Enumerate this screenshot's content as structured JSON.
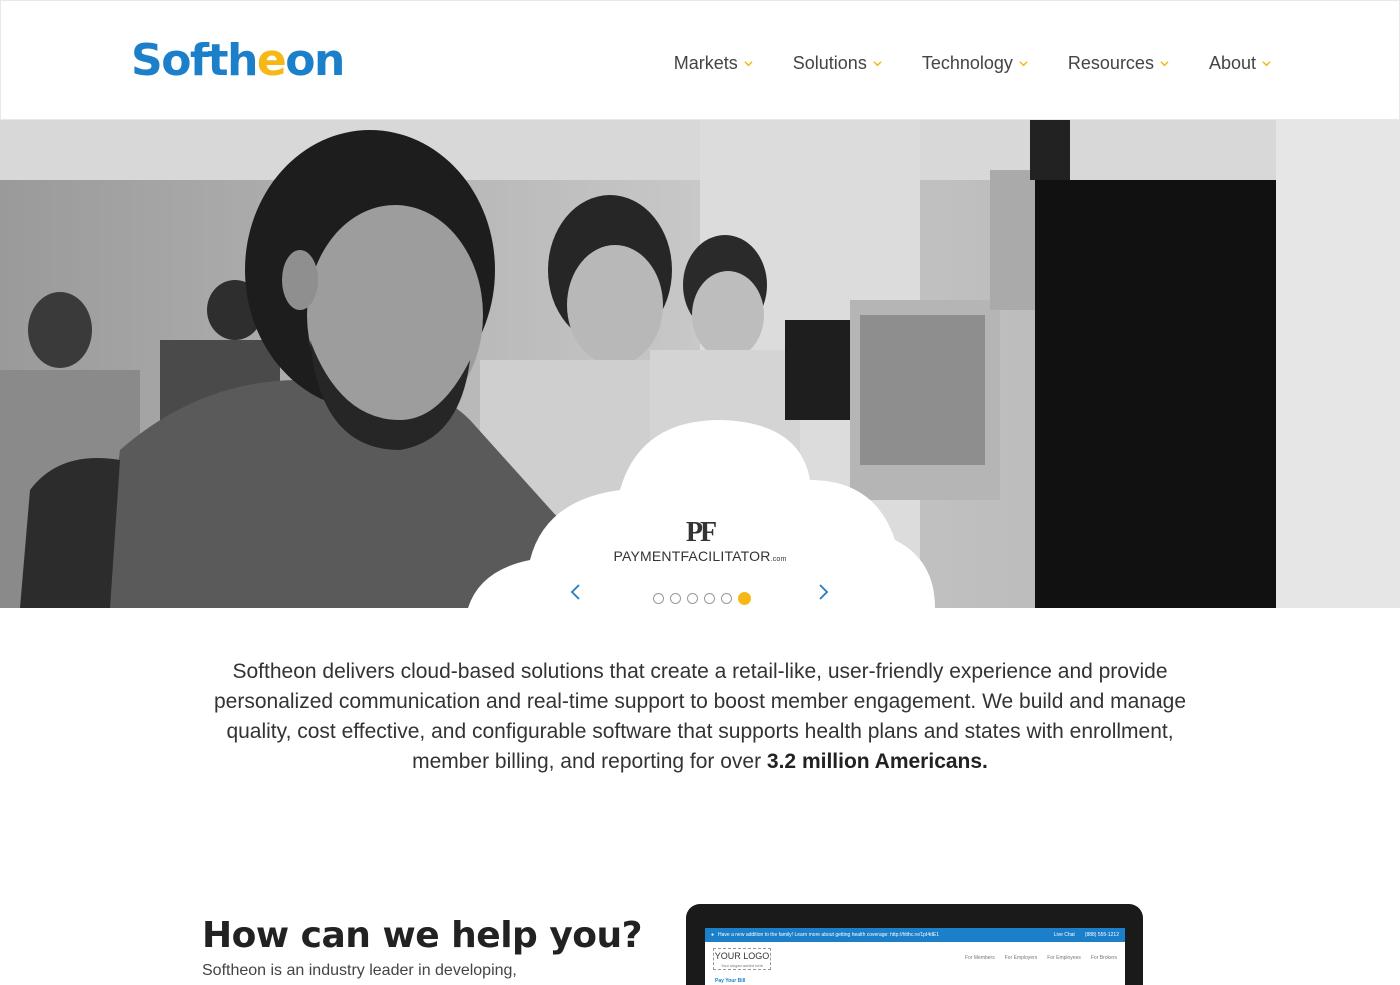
{
  "header": {
    "logo": {
      "part1": "Softh",
      "part2": "e",
      "part3": "on"
    },
    "nav": [
      {
        "label": "Markets"
      },
      {
        "label": "Solutions"
      },
      {
        "label": "Technology"
      },
      {
        "label": "Resources"
      },
      {
        "label": "About"
      }
    ]
  },
  "hero": {
    "partner_logo": {
      "mark": "PF",
      "name": "PAYMENTFACILITATOR",
      "suffix": ".com"
    },
    "carousel": {
      "slide_count": 6,
      "active_index": 5
    },
    "colors": {
      "dot_active": "#f6b817",
      "arrow": "#1b7fc9"
    }
  },
  "intro": {
    "text": "Softheon delivers cloud-based solutions that create a retail-like, user-friendly experience and provide personalized communication and real-time support to boost member engagement. We build and manage quality, cost effective, and configurable software that supports health plans and states with enrollment, member billing, and reporting for over ",
    "highlight": "3.2 million Americans."
  },
  "help": {
    "title": "How can we help you?",
    "subtitle": "Softheon is an industry leader in developing,"
  },
  "mockup": {
    "top_bar": "Have a new addition to the family! Learn more about getting health coverage: http://hlthc.re/1pI4dE1",
    "live_chat": "Live Chat",
    "phone": "(888) 555-1212",
    "logo": "YOUR LOGO",
    "slogan": "Your slogan added here",
    "nav": [
      "For Members",
      "For Employers",
      "For Employees",
      "For Brokers"
    ],
    "link": "Pay Your Bill"
  },
  "colors": {
    "brand_blue": "#1b7fc9",
    "brand_yellow": "#f6b817"
  }
}
